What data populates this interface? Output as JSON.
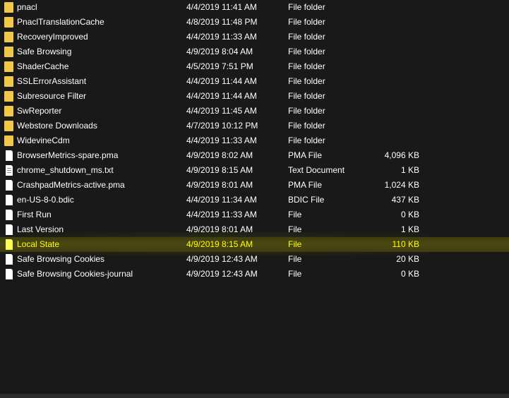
{
  "rows": [
    {
      "name": "pnacl",
      "date": "4/4/2019 11:41 AM",
      "type": "File folder",
      "size": "",
      "icon": "folder-icon"
    },
    {
      "name": "PnaclTranslationCache",
      "date": "4/8/2019 11:48 PM",
      "type": "File folder",
      "size": "",
      "icon": "folder-icon"
    },
    {
      "name": "RecoveryImproved",
      "date": "4/4/2019 11:33 AM",
      "type": "File folder",
      "size": "",
      "icon": "folder-icon"
    },
    {
      "name": "Safe Browsing",
      "date": "4/9/2019 8:04 AM",
      "type": "File folder",
      "size": "",
      "icon": "folder-icon"
    },
    {
      "name": "ShaderCache",
      "date": "4/5/2019 7:51 PM",
      "type": "File folder",
      "size": "",
      "icon": "folder-icon"
    },
    {
      "name": "SSLErrorAssistant",
      "date": "4/4/2019 11:44 AM",
      "type": "File folder",
      "size": "",
      "icon": "folder-icon"
    },
    {
      "name": "Subresource Filter",
      "date": "4/4/2019 11:44 AM",
      "type": "File folder",
      "size": "",
      "icon": "folder-icon"
    },
    {
      "name": "SwReporter",
      "date": "4/4/2019 11:45 AM",
      "type": "File folder",
      "size": "",
      "icon": "folder-icon"
    },
    {
      "name": "Webstore Downloads",
      "date": "4/7/2019 10:12 PM",
      "type": "File folder",
      "size": "",
      "icon": "folder-icon"
    },
    {
      "name": "WidevineCdm",
      "date": "4/4/2019 11:33 AM",
      "type": "File folder",
      "size": "",
      "icon": "folder-icon"
    },
    {
      "name": "BrowserMetrics-spare.pma",
      "date": "4/9/2019 8:02 AM",
      "type": "PMA File",
      "size": "4,096 KB",
      "icon": "file-icon"
    },
    {
      "name": "chrome_shutdown_ms.txt",
      "date": "4/9/2019 8:15 AM",
      "type": "Text Document",
      "size": "1 KB",
      "icon": "text-file-icon"
    },
    {
      "name": "CrashpadMetrics-active.pma",
      "date": "4/9/2019 8:01 AM",
      "type": "PMA File",
      "size": "1,024 KB",
      "icon": "file-icon"
    },
    {
      "name": "en-US-8-0.bdic",
      "date": "4/4/2019 11:34 AM",
      "type": "BDIC File",
      "size": "437 KB",
      "icon": "file-icon"
    },
    {
      "name": "First Run",
      "date": "4/4/2019 11:33 AM",
      "type": "File",
      "size": "0 KB",
      "icon": "file-icon"
    },
    {
      "name": "Last Version",
      "date": "4/9/2019 8:01 AM",
      "type": "File",
      "size": "1 KB",
      "icon": "file-icon"
    },
    {
      "name": "Local State",
      "date": "4/9/2019 8:15 AM",
      "type": "File",
      "size": "110 KB",
      "icon": "file-icon",
      "highlighted": true
    },
    {
      "name": "Safe Browsing Cookies",
      "date": "4/9/2019 12:43 AM",
      "type": "File",
      "size": "20 KB",
      "icon": "file-icon"
    },
    {
      "name": "Safe Browsing Cookies-journal",
      "date": "4/9/2019 12:43 AM",
      "type": "File",
      "size": "0 KB",
      "icon": "file-icon"
    }
  ],
  "colors": {
    "background": "#191919",
    "text": "#ffffff",
    "folder": "#f0c84a",
    "highlight_text": "#ffff00",
    "highlight_bg": "#4a4810"
  }
}
